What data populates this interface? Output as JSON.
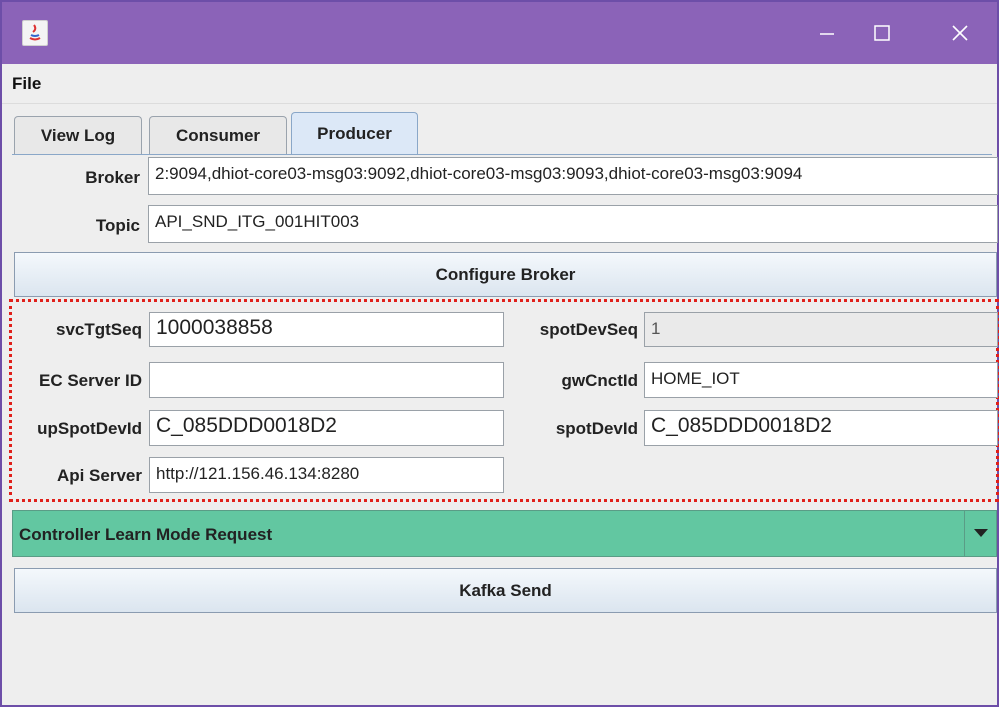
{
  "menu": {
    "file": "File"
  },
  "tabs": [
    {
      "label": "View Log"
    },
    {
      "label": "Consumer"
    },
    {
      "label": "Producer"
    }
  ],
  "broker": {
    "label": "Broker",
    "value": "2:9094,dhiot-core03-msg03:9092,dhiot-core03-msg03:9093,dhiot-core03-msg03:9094"
  },
  "topic": {
    "label": "Topic",
    "value": "API_SND_ITG_001HIT003"
  },
  "configure_button": "Configure Broker",
  "form": {
    "svcTgtSeq_label": "svcTgtSeq",
    "svcTgtSeq_value": "1000038858",
    "spotDevSeq_label": "spotDevSeq",
    "spotDevSeq_value": "1",
    "ec_server_label": "EC Server ID",
    "ec_server_value": "",
    "gwCnctId_label": "gwCnctId",
    "gwCnctId_value": "HOME_IOT",
    "upSpotDevId_label": "upSpotDevId",
    "upSpotDevId_value": "C_085DDD0018D2",
    "spotDevId_label": "spotDevId",
    "spotDevId_value": "C_085DDD0018D2",
    "api_server_label": "Api Server",
    "api_server_value": "http://121.156.46.134:8280"
  },
  "request_select": {
    "value": "Controller Learn Mode Request"
  },
  "send_button": "Kafka Send",
  "colors": {
    "titlebar": "#8b63b8",
    "combo_bg": "#62c7a1",
    "highlight": "#e0201a"
  }
}
